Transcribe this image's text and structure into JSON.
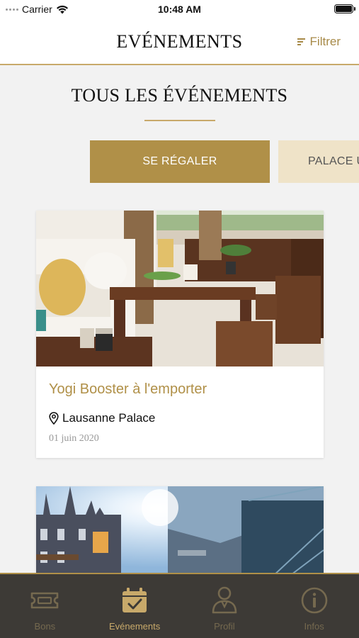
{
  "status_bar": {
    "carrier": "Carrier",
    "time": "10:48 AM"
  },
  "navbar": {
    "title": "EVÉNEMENTS",
    "filter_label": "Filtrer"
  },
  "section": {
    "title": "TOUS LES ÉVÉNEMENTS"
  },
  "categories": [
    "SE RÉGALER",
    "PALACE U"
  ],
  "events": [
    {
      "title": "Yogi Booster à l'emporter",
      "location": "Lausanne Palace",
      "date": "01 juin 2020"
    }
  ],
  "tabbar": {
    "items": [
      {
        "label": "Bons",
        "icon": "ticket-icon"
      },
      {
        "label": "Evénements",
        "icon": "calendar-check-icon"
      },
      {
        "label": "Profil",
        "icon": "person-icon"
      },
      {
        "label": "Infos",
        "icon": "info-icon"
      }
    ],
    "active": "Evénements"
  },
  "colors": {
    "accent": "#b09048",
    "accent_light": "#efe3c8",
    "tabbar_bg": "#3d3a36",
    "background": "#f2f2f2"
  }
}
